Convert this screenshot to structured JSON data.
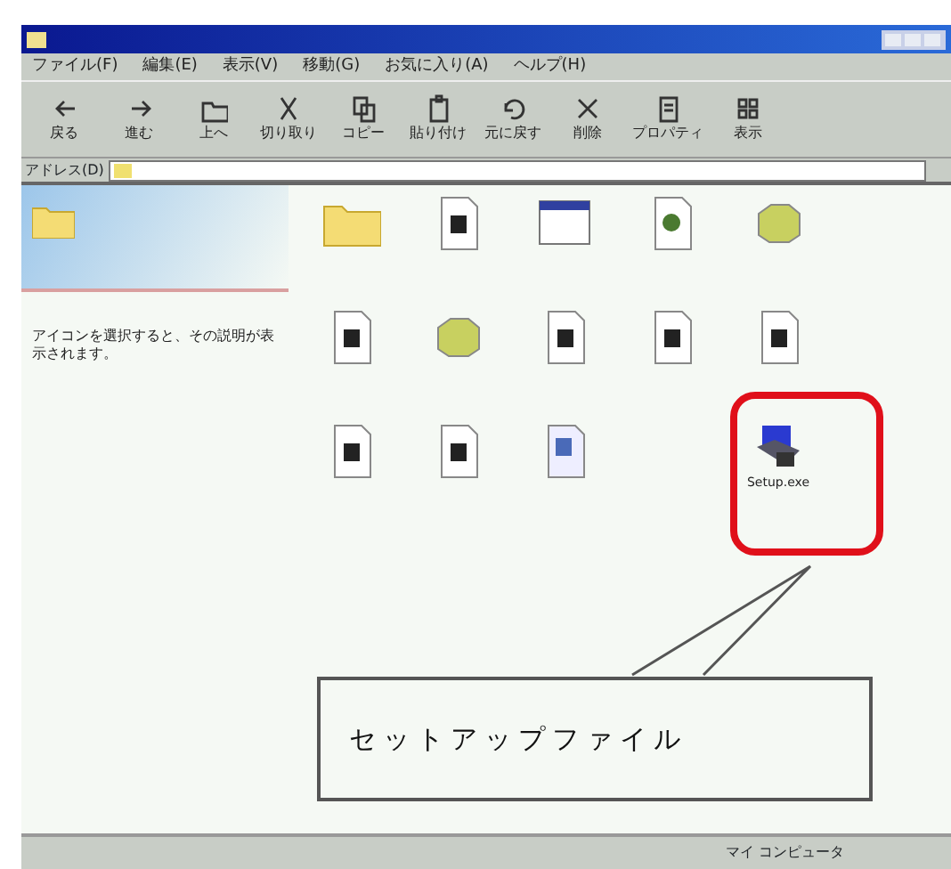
{
  "menu": [
    "ファイル(F)",
    "編集(E)",
    "表示(V)",
    "移動(G)",
    "お気に入り(A)",
    "ヘルプ(H)"
  ],
  "toolbar": [
    {
      "kind": "back",
      "label": "戻る"
    },
    {
      "kind": "forward",
      "label": "進む"
    },
    {
      "kind": "up",
      "label": "上へ"
    },
    {
      "kind": "cut",
      "label": "切り取り"
    },
    {
      "kind": "copy",
      "label": "コピー"
    },
    {
      "kind": "paste",
      "label": "貼り付け"
    },
    {
      "kind": "undo",
      "label": "元に戻す"
    },
    {
      "kind": "delete",
      "label": "削除"
    },
    {
      "kind": "properties",
      "label": "プロパティ"
    },
    {
      "kind": "views",
      "label": "表示"
    }
  ],
  "address": {
    "label": "アドレス(D)"
  },
  "side_panel": {
    "description": "アイコンを選択すると、その説明が表示されます。"
  },
  "icon_rows": [
    [
      {
        "kind": "folder"
      },
      {
        "kind": "document"
      },
      {
        "kind": "window"
      },
      {
        "kind": "image"
      },
      {
        "kind": "package"
      }
    ],
    [
      {
        "kind": "document"
      },
      {
        "kind": "package"
      },
      {
        "kind": "document"
      },
      {
        "kind": "document"
      },
      {
        "kind": "document"
      }
    ],
    [
      {
        "kind": "document"
      },
      {
        "kind": "document"
      },
      {
        "kind": "text"
      }
    ]
  ],
  "setup_file": {
    "label": "Setup.exe",
    "highlighted": true
  },
  "callout": "セットアップファイル",
  "status_bar": "マイ コンピュータ"
}
